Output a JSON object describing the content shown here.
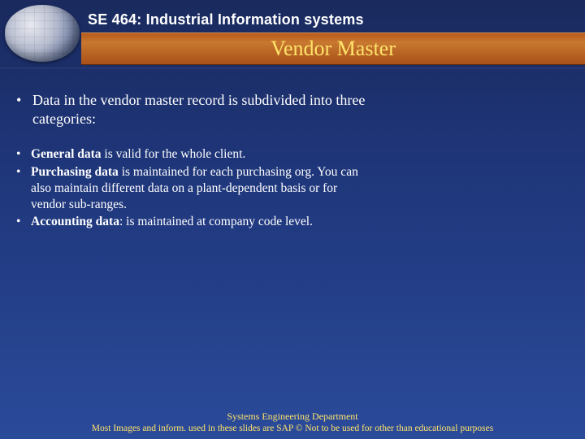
{
  "header": {
    "course_title": "SE 464: Industrial Information systems",
    "slide_title": "Vendor Master"
  },
  "content": {
    "intro": "Data in the vendor master record is subdivided into three categories:",
    "items": [
      {
        "bold": "General data",
        "rest": " is valid for the whole client."
      },
      {
        "bold": "Purchasing data",
        "rest": " is maintained for each purchasing org. You can also maintain different data on a plant-dependent basis or for vendor sub-ranges."
      },
      {
        "bold": "Accounting data",
        "rest": ": is maintained at company code level."
      }
    ]
  },
  "footer": {
    "line1": "Systems Engineering Department",
    "line2": "Most Images and inform. used in these slides are SAP © Not to be used for other than educational purposes"
  }
}
